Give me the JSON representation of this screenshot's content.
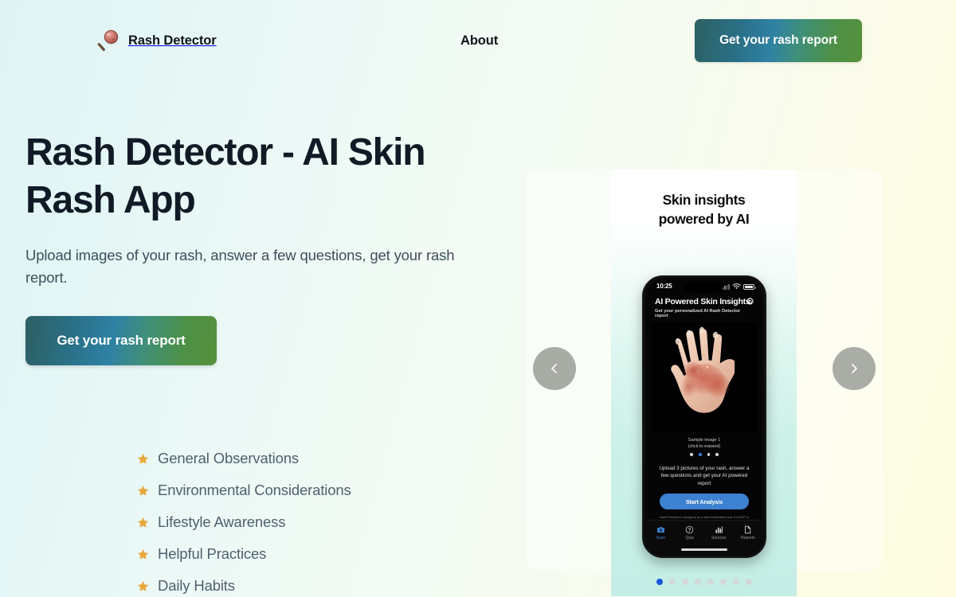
{
  "header": {
    "brand_name": "Rash Detector",
    "brand_logo_icon": "magnifying-glass-icon",
    "nav_about": "About",
    "cta_label": "Get your rash report",
    "cta_gradient_from": "#2d6063",
    "cta_gradient_to": "#56913c"
  },
  "hero": {
    "title": "Rash Detector - AI Skin Rash App",
    "subtitle": "Upload images of your rash, answer a few questions, get your rash report.",
    "cta_label": "Get your rash report",
    "features": [
      {
        "label": "General Observations",
        "icon": "star-icon"
      },
      {
        "label": "Environmental Considerations",
        "icon": "star-icon"
      },
      {
        "label": "Lifestyle Awareness",
        "icon": "star-icon"
      },
      {
        "label": "Helpful Practices",
        "icon": "star-icon"
      },
      {
        "label": "Daily Habits",
        "icon": "star-icon"
      }
    ],
    "star_color": "#e8a93c"
  },
  "carousel": {
    "prev_icon": "chevron-left-icon",
    "next_icon": "chevron-right-icon",
    "slide": {
      "title_line1": "Skin insights",
      "title_line2": "powered by AI"
    },
    "dots": {
      "total": 8,
      "active_index": 0,
      "active_color": "#1a56db",
      "inactive_color": "#d2d6da"
    }
  },
  "phone": {
    "status": {
      "time": "10:25",
      "signal_icon": "signal-bars-icon",
      "wifi_icon": "wifi-icon",
      "battery_icon": "battery-icon"
    },
    "app": {
      "title": "AI Powered Skin Insights",
      "settings_icon": "gear-icon",
      "tagline": "Get your personalized AI Rash Detector report",
      "photo_alt": "hand-with-rash-photo",
      "caption_line1": "Sample image 1",
      "caption_line2": "(click to expand)",
      "image_dots_total": 4,
      "image_dots_active_index": 1,
      "image_dot_active_color": "#3a7fd5",
      "upload_text": "Upload 3 pictures of your rash, answer a few questions and get your AI powered report",
      "start_button": "Start Analysis",
      "start_button_color": "#3d82d0",
      "disclaimer": "Rash Detector is designed as a self-examination tool. It is NOT a diagnostic tool and should NOT be considered a substitute for professional medical advice, diagnosis, or treatment.",
      "tabs": [
        {
          "label": "Scan",
          "icon": "camera-icon",
          "active": true
        },
        {
          "label": "Quiz",
          "icon": "question-icon",
          "active": false
        },
        {
          "label": "Sources",
          "icon": "bar-chart-icon",
          "active": false
        },
        {
          "label": "Reports",
          "icon": "document-icon",
          "active": false
        }
      ]
    }
  }
}
